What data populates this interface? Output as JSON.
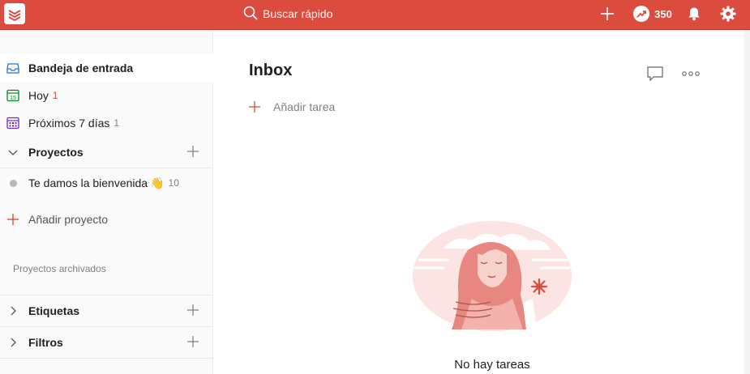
{
  "topbar": {
    "search_placeholder": "Buscar rápido",
    "karma_points": "350",
    "icons": [
      "todoist-logo-icon",
      "search-icon",
      "add-icon",
      "karma-trend-icon",
      "bell-icon",
      "gear-icon"
    ],
    "color": "#db4c3f"
  },
  "sidebar": {
    "items": [
      {
        "label": "Bandeja de entrada",
        "count": "",
        "icon": "inbox-icon",
        "active": true
      },
      {
        "label": "Hoy",
        "count": "1",
        "icon": "calendar-today-icon"
      },
      {
        "label": "Próximos 7 días",
        "count": "1",
        "icon": "calendar-week-icon"
      }
    ],
    "projects": {
      "heading": "Proyectos",
      "items": [
        {
          "label": "Te damos la bienvenida",
          "emoji": "👋",
          "count": "10"
        }
      ],
      "add_label": "Añadir proyecto",
      "archived_label": "Proyectos archivados"
    },
    "labels_heading": "Etiquetas",
    "filters_heading": "Filtros"
  },
  "main": {
    "title": "Inbox",
    "add_task_label": "Añadir tarea",
    "empty_state_text": "No hay tareas"
  }
}
